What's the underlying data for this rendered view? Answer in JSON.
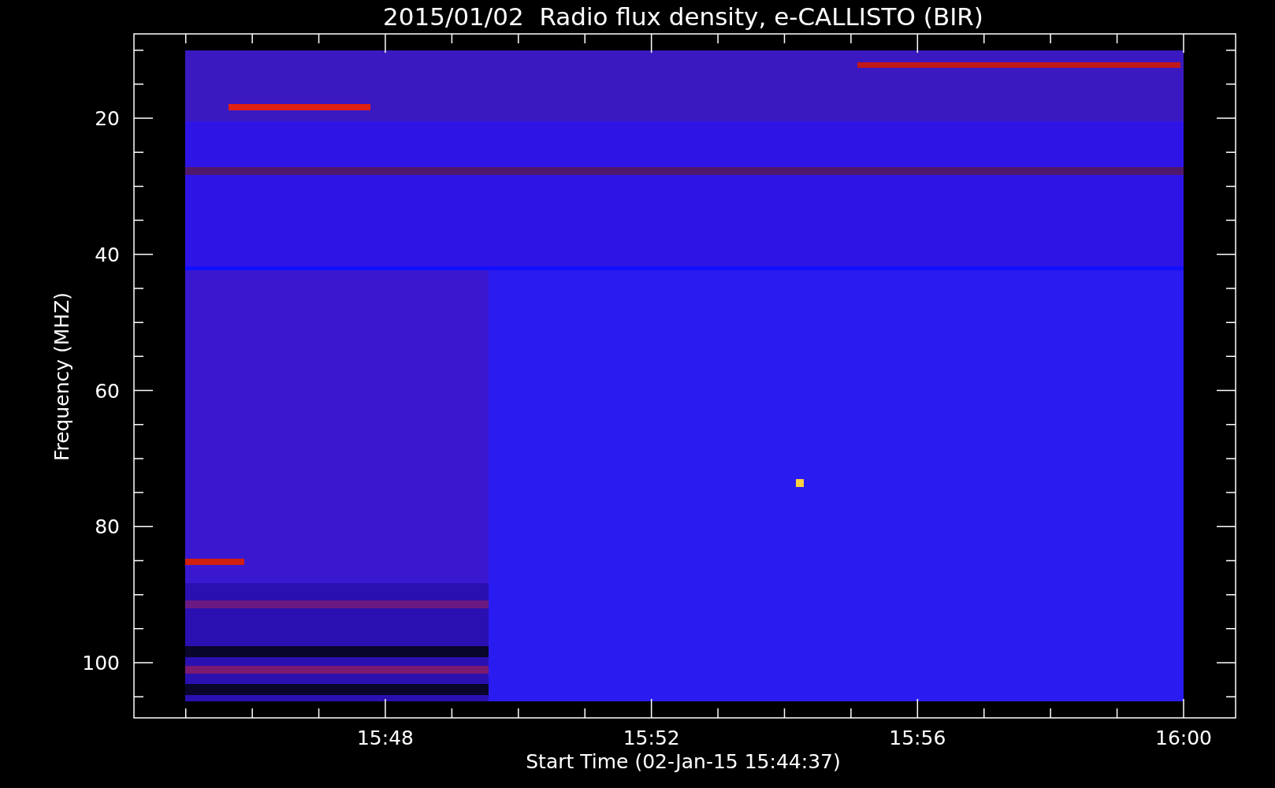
{
  "title": "2015/01/02  Radio flux density, e-CALLISTO (BIR)",
  "y_axis": {
    "label": "Frequency (MHZ)",
    "ticks": [
      "20",
      "40",
      "60",
      "80",
      "100"
    ]
  },
  "x_axis": {
    "label": "Start Time (02-Jan-15 15:44:37)",
    "ticks": [
      "15:48",
      "15:52",
      "15:56",
      "16:00"
    ]
  }
}
